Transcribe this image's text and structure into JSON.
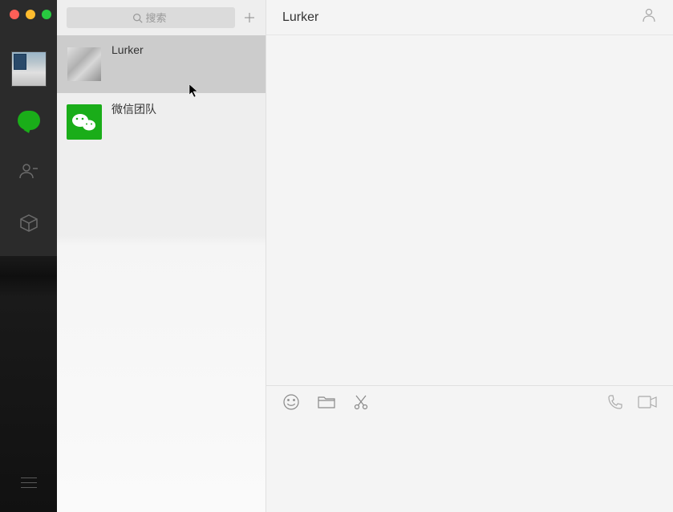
{
  "search": {
    "placeholder": "搜索"
  },
  "chats": [
    {
      "name": "Lurker",
      "selected": true
    },
    {
      "name": "微信团队",
      "selected": false
    }
  ],
  "header": {
    "title": "Lurker"
  }
}
